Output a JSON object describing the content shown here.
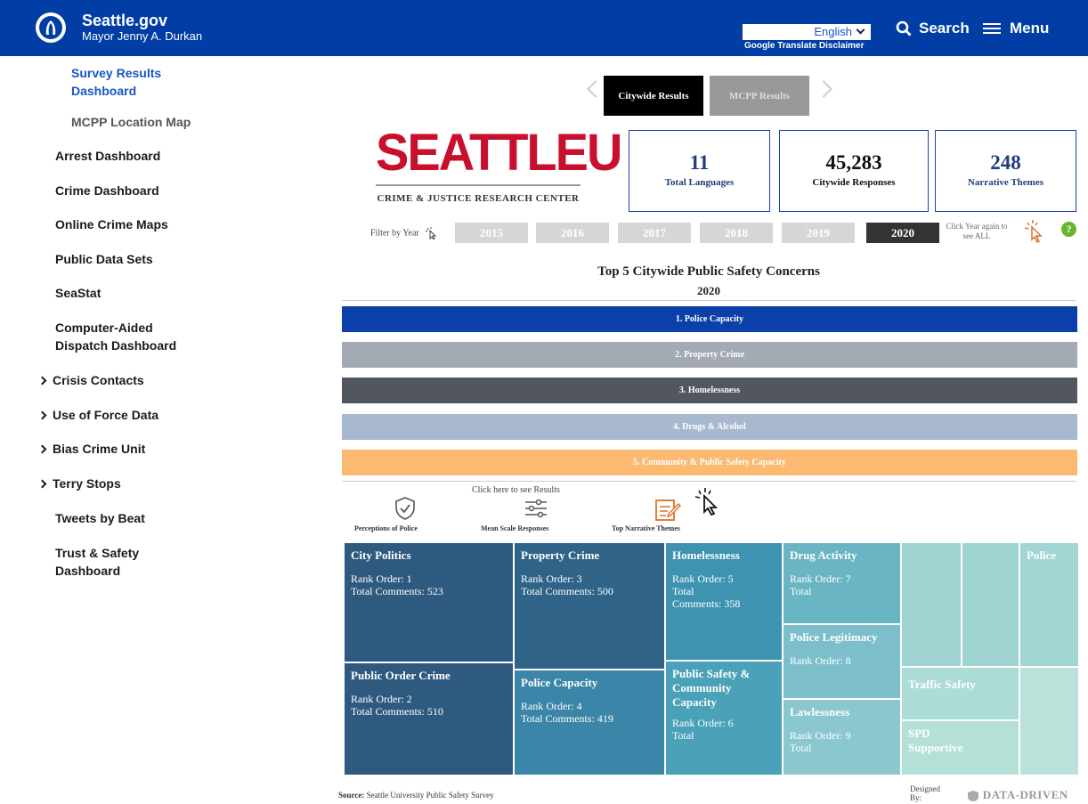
{
  "header": {
    "site": "Seattle.gov",
    "mayor": "Mayor Jenny A. Durkan",
    "language": "English",
    "translate_disclaimer": "Google Translate Disclaimer",
    "search": "Search",
    "menu": "Menu"
  },
  "sidebar": {
    "items": [
      {
        "label": "Survey Results Dashboard",
        "line1": "Survey Results",
        "line2": "Dashboard"
      },
      {
        "label": "MCPP Location Map"
      },
      {
        "label": "Arrest Dashboard"
      },
      {
        "label": "Crime Dashboard"
      },
      {
        "label": "Online Crime Maps"
      },
      {
        "label": "Public Data Sets"
      },
      {
        "label": "SeaStat"
      },
      {
        "label": "Computer-Aided Dispatch Dashboard",
        "line1": "Computer-Aided",
        "line2": "Dispatch Dashboard"
      },
      {
        "label": "Crisis Contacts"
      },
      {
        "label": "Use of Force Data"
      },
      {
        "label": "Bias Crime Unit"
      },
      {
        "label": "Terry Stops"
      },
      {
        "label": "Tweets by Beat"
      },
      {
        "label": "Trust & Safety Dashboard",
        "line1": "Trust & Safety",
        "line2": "Dashboard"
      }
    ]
  },
  "dashboard": {
    "tabs": [
      "Citywide Results",
      "MCPP Results"
    ],
    "logo": {
      "word": "SEATTLEU",
      "subtitle": "CRIME & JUSTICE RESEARCH CENTER"
    },
    "kpis": [
      {
        "value": "11",
        "label": "Total Languages"
      },
      {
        "value": "45,283",
        "label": "Citywide Responses"
      },
      {
        "value": "248",
        "label": "Narrative Themes"
      }
    ],
    "filter_label": "Filter by Year",
    "years": [
      "2015",
      "2016",
      "2017",
      "2018",
      "2019",
      "2020"
    ],
    "selected_year": "2020",
    "click_note": "Click Year again to see ALL",
    "help": "?",
    "concerns_title": "Top 5 Citywide Public Safety Concerns",
    "concerns_year": "2020",
    "concerns": [
      "1. Police Capacity",
      "2. Property Crime",
      "3. Homelessness",
      "4. Drugs & Alcohol",
      "5. Community & Public Safety Capacity"
    ],
    "concern_colors": [
      "#0b3fa9",
      "#a3aab3",
      "#52575f",
      "#a8b8cf",
      "#fbb971"
    ],
    "click_here": "Click here to see Results",
    "views": [
      "Perceptions of Police",
      "Mean Scale Responses",
      "Top Narrative Themes"
    ],
    "treemap": [
      {
        "title": "City Politics",
        "lines": [
          "Rank Order: 1",
          "Total Comments: 523"
        ]
      },
      {
        "title": "Public Order Crime",
        "lines": [
          "Rank Order: 2",
          "Total Comments: 510"
        ]
      },
      {
        "title": "Property Crime",
        "lines": [
          "Rank Order: 3",
          "Total Comments: 500"
        ]
      },
      {
        "title": "Police Capacity",
        "lines": [
          "Rank Order: 4",
          "Total Comments: 419"
        ]
      },
      {
        "title": "Homelessness",
        "lines": [
          "Rank Order: 5",
          "Total",
          "Comments: 358"
        ]
      },
      {
        "title": "Public Safety & Community Capacity",
        "lines": [
          "Rank Order: 6",
          "Total"
        ]
      },
      {
        "title": "Drug Activity",
        "lines": [
          "Rank Order: 7",
          "Total"
        ]
      },
      {
        "title": "Police Legitimacy",
        "lines": [
          "Rank Order: 8"
        ]
      },
      {
        "title": "Lawlessness",
        "lines": [
          "Rank Order: 9",
          "Total"
        ]
      },
      {
        "title": "Police",
        "lines": []
      },
      {
        "title": "Traffic Safety",
        "lines": []
      },
      {
        "title": "SPD Supportive",
        "lines": []
      }
    ],
    "source_label": "Source:",
    "source": "Seattle University Public Safety Survey",
    "designed_by": "Designed By:",
    "designer": "DATA-DRIVEN"
  }
}
